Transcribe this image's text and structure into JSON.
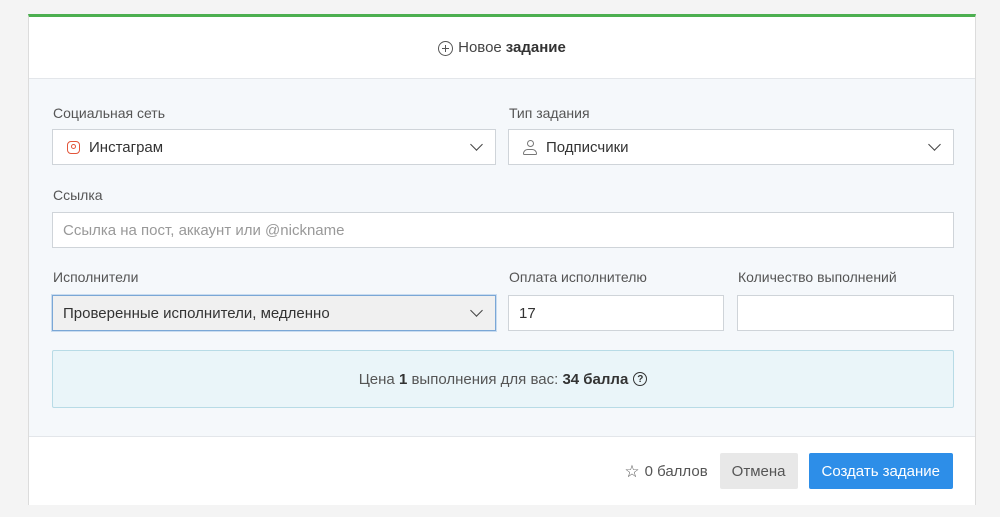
{
  "header": {
    "title_plain": "Новое",
    "title_bold": "задание",
    "icon": "plus-circle-icon"
  },
  "form": {
    "social_label": "Социальная сеть",
    "social_value": "Инстаграм",
    "social_icon": "instagram-icon",
    "task_type_label": "Тип задания",
    "task_type_value": "Подписчики",
    "task_type_icon": "user-icon",
    "link_label": "Ссылка",
    "link_value": "",
    "link_placeholder": "Ссылка на пост, аккаунт или @nickname",
    "performers_label": "Исполнители",
    "performers_value": "Проверенные исполнители, медленно",
    "payment_label": "Оплата исполнителю",
    "payment_value": "17",
    "count_label": "Количество выполнений",
    "count_value": ""
  },
  "price": {
    "prefix": "Цена ",
    "count": "1",
    "middle": " выполнения для вас: ",
    "amount": "34 балла",
    "help_icon": "question-circle-icon"
  },
  "footer": {
    "balance": "0 баллов",
    "balance_icon": "star-icon",
    "cancel_label": "Отмена",
    "create_label": "Создать задание"
  },
  "colors": {
    "accent_top": "#4caf50",
    "primary_button": "#2d8ee8",
    "info_box_bg": "#eaf5f9"
  }
}
